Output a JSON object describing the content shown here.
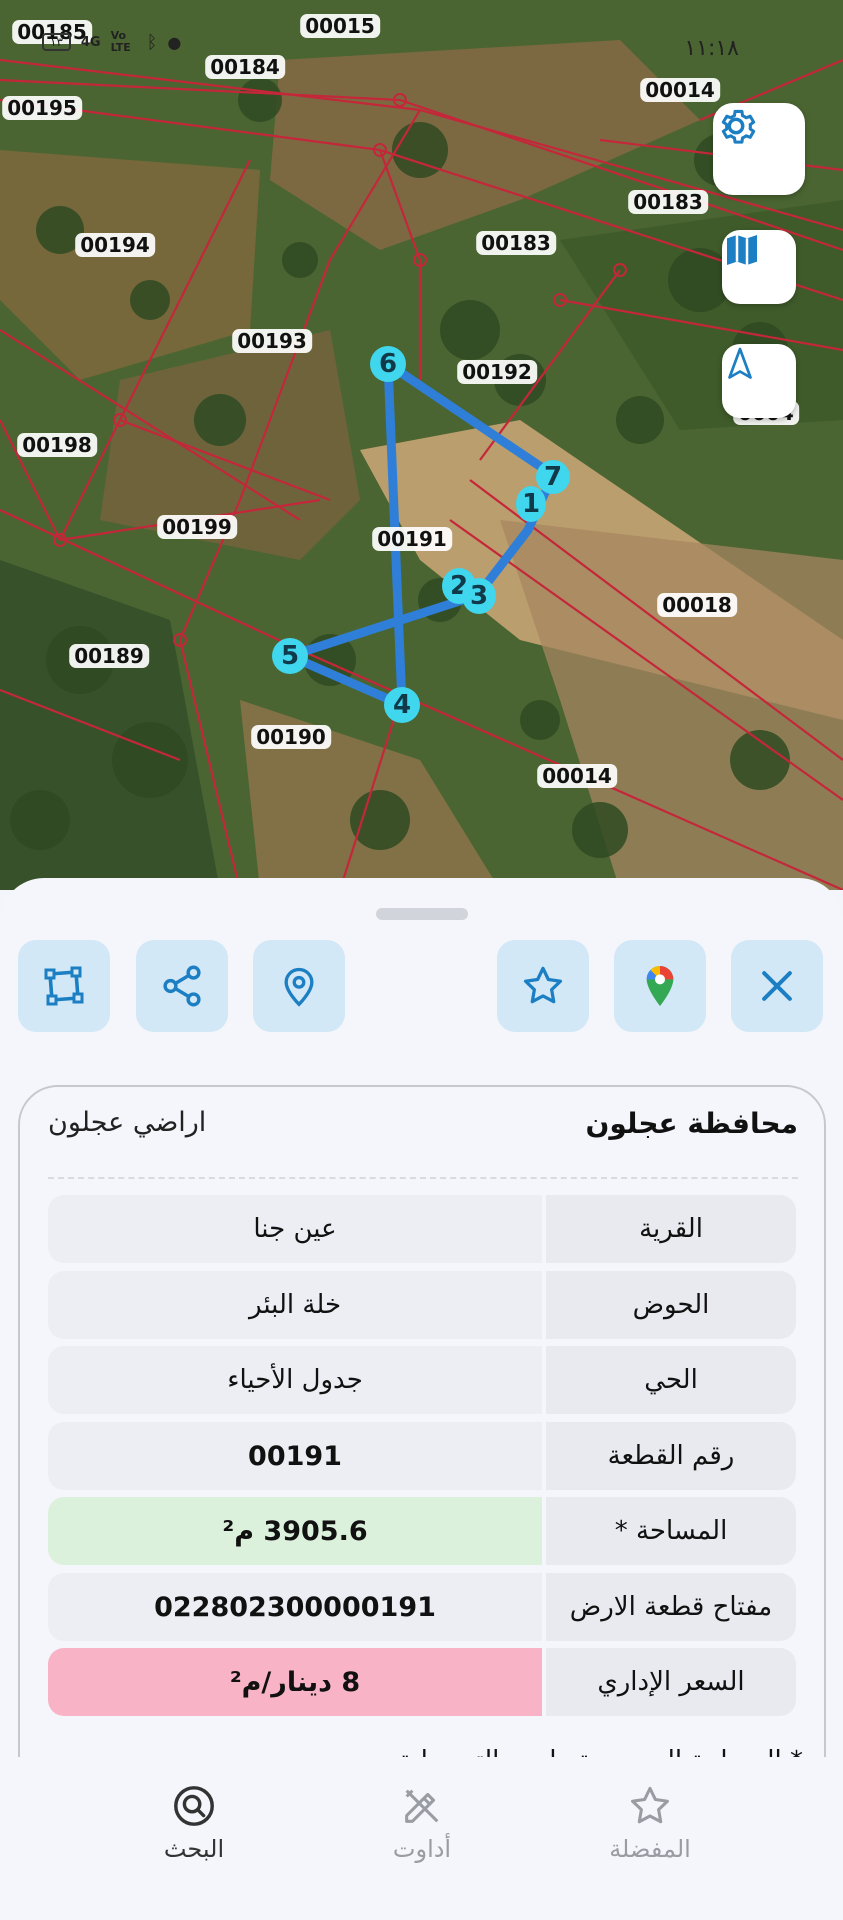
{
  "status_bar": {
    "time": "١١:١٨",
    "network": "4G",
    "volte": "Vo LTE",
    "battery": "١٣"
  },
  "map": {
    "parcel_labels": [
      "00185",
      "00015",
      "00184",
      "00195",
      "00014",
      "00183",
      "00194",
      "00183",
      "00193",
      "00192",
      "0004",
      "00198",
      "00199",
      "00191",
      "00018",
      "00189",
      "00190",
      "00014"
    ],
    "vertex_labels": [
      "6",
      "7",
      "1",
      "2",
      "3",
      "5",
      "4"
    ]
  },
  "map_controls": {
    "settings": "gear-icon",
    "layers": "map-icon",
    "north": "navigation-arrow-icon"
  },
  "actions": [
    "polygon-icon",
    "share-icon",
    "location-pin-icon",
    "star-icon",
    "google-maps-icon",
    "close-icon"
  ],
  "card": {
    "title": "محافظة عجلون",
    "subtitle": "اراضي عجلون",
    "rows": [
      {
        "key": "القرية",
        "value": "عين جنا"
      },
      {
        "key": "الحوض",
        "value": "خلة البئر"
      },
      {
        "key": "الحي",
        "value": "جدول الأحياء"
      },
      {
        "key": "رقم القطعة",
        "value": "00191"
      },
      {
        "key": "المساحة *",
        "value": "3905.6 م²"
      },
      {
        "key": "مفتاح قطعة الارض",
        "value": "022802300000191"
      },
      {
        "key": "السعر الإداري",
        "value": "8 دينار/م²"
      }
    ],
    "footnote": "* المساحة المحسوبة وليس التسجيلية"
  },
  "colors": {
    "accent_blue": "#1c7fc4",
    "polygon": "#2f7fd8",
    "vertex": "#3fd6ee",
    "area_bg": "#dcf1dc",
    "price_bg": "#f8b4c6"
  },
  "nav": {
    "search": "البحث",
    "tools": "أداوت",
    "favorites": "المفضلة"
  }
}
